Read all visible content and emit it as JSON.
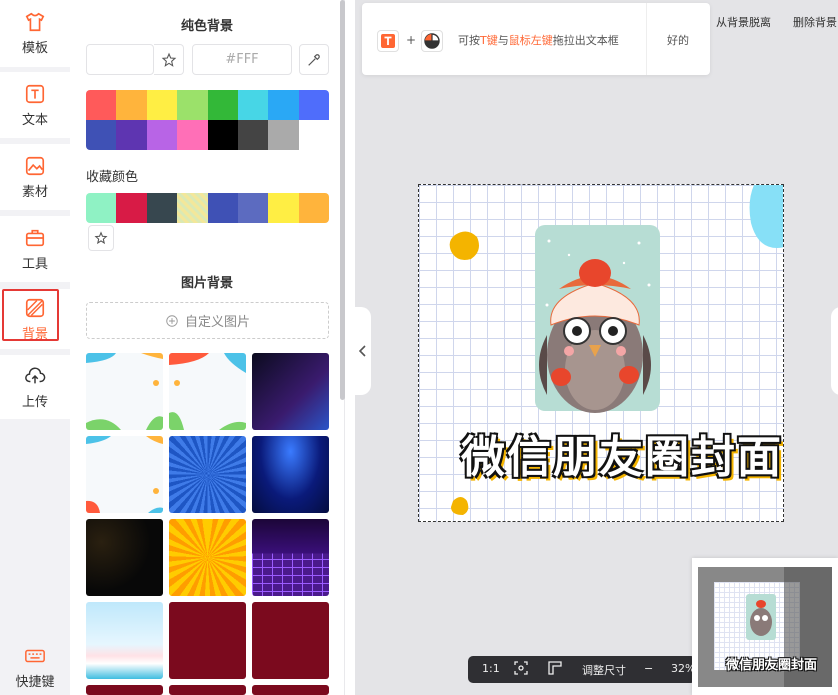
{
  "nav": {
    "items": [
      {
        "label": "模板",
        "icon": "shirt-icon"
      },
      {
        "label": "文本",
        "icon": "text-icon"
      },
      {
        "label": "素材",
        "icon": "image-icon"
      },
      {
        "label": "工具",
        "icon": "toolbox-icon"
      },
      {
        "label": "背景",
        "icon": "background-icon"
      },
      {
        "label": "上传",
        "icon": "upload-icon"
      },
      {
        "label": "快捷键",
        "icon": "keyboard-icon"
      }
    ],
    "active": "背景"
  },
  "panel": {
    "solid_title": "纯色背景",
    "hex_placeholder": "#FFF",
    "palette": [
      "#ff5a5a",
      "#ffb43c",
      "#ffee44",
      "#9be16a",
      "#33b838",
      "#47d6e6",
      "#2aa8f5",
      "#4f6dfb",
      "#3f51b5",
      "#5e35b1",
      "#b864e6",
      "#ff6fb7",
      "#000000",
      "#444444",
      "#aaaaaa",
      "#ffffff"
    ],
    "favorites_label": "收藏颜色",
    "favorites": [
      "#8ff2c4",
      "#d81b46",
      "#37474f",
      "pattern",
      "#3f51b5",
      "#5c6bc0",
      "#ffee44",
      "#ffb43c"
    ],
    "image_title": "图片背景",
    "custom_image_label": "自定义图片"
  },
  "tip": {
    "text_pre": "可按",
    "key_t": "T键",
    "text_mid": "与",
    "key_mouse": "鼠标左键",
    "text_post": "拖拉出文本框",
    "ok_label": "好的"
  },
  "toolbar_links": {
    "detach": "从背景脱离",
    "delete": "删除背景"
  },
  "canvas": {
    "title": "微信朋友圈封面"
  },
  "bottom_bar": {
    "ratio": "1:1",
    "resize_label": "调整尺寸",
    "zoom_minus": "−",
    "zoom": "32%"
  },
  "colors": {
    "accent": "#ff6633",
    "active_border": "#e53935"
  }
}
